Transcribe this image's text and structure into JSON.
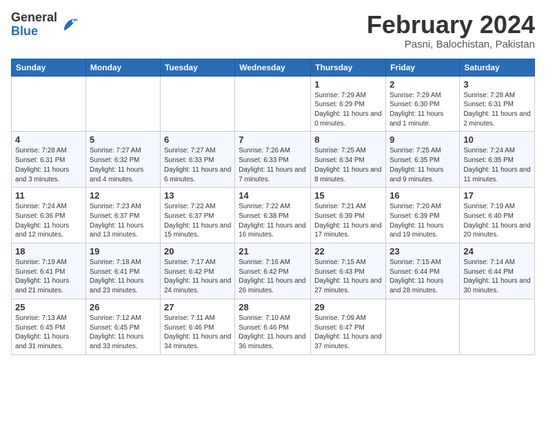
{
  "logo": {
    "general": "General",
    "blue": "Blue"
  },
  "title": "February 2024",
  "subtitle": "Pasni, Balochistan, Pakistan",
  "days_of_week": [
    "Sunday",
    "Monday",
    "Tuesday",
    "Wednesday",
    "Thursday",
    "Friday",
    "Saturday"
  ],
  "weeks": [
    [
      {
        "day": "",
        "info": ""
      },
      {
        "day": "",
        "info": ""
      },
      {
        "day": "",
        "info": ""
      },
      {
        "day": "",
        "info": ""
      },
      {
        "day": "1",
        "info": "Sunrise: 7:29 AM\nSunset: 6:29 PM\nDaylight: 11 hours and 0 minutes."
      },
      {
        "day": "2",
        "info": "Sunrise: 7:29 AM\nSunset: 6:30 PM\nDaylight: 11 hours and 1 minute."
      },
      {
        "day": "3",
        "info": "Sunrise: 7:28 AM\nSunset: 6:31 PM\nDaylight: 11 hours and 2 minutes."
      }
    ],
    [
      {
        "day": "4",
        "info": "Sunrise: 7:28 AM\nSunset: 6:31 PM\nDaylight: 11 hours and 3 minutes."
      },
      {
        "day": "5",
        "info": "Sunrise: 7:27 AM\nSunset: 6:32 PM\nDaylight: 11 hours and 4 minutes."
      },
      {
        "day": "6",
        "info": "Sunrise: 7:27 AM\nSunset: 6:33 PM\nDaylight: 11 hours and 6 minutes."
      },
      {
        "day": "7",
        "info": "Sunrise: 7:26 AM\nSunset: 6:33 PM\nDaylight: 11 hours and 7 minutes."
      },
      {
        "day": "8",
        "info": "Sunrise: 7:25 AM\nSunset: 6:34 PM\nDaylight: 11 hours and 8 minutes."
      },
      {
        "day": "9",
        "info": "Sunrise: 7:25 AM\nSunset: 6:35 PM\nDaylight: 11 hours and 9 minutes."
      },
      {
        "day": "10",
        "info": "Sunrise: 7:24 AM\nSunset: 6:35 PM\nDaylight: 11 hours and 11 minutes."
      }
    ],
    [
      {
        "day": "11",
        "info": "Sunrise: 7:24 AM\nSunset: 6:36 PM\nDaylight: 11 hours and 12 minutes."
      },
      {
        "day": "12",
        "info": "Sunrise: 7:23 AM\nSunset: 6:37 PM\nDaylight: 11 hours and 13 minutes."
      },
      {
        "day": "13",
        "info": "Sunrise: 7:22 AM\nSunset: 6:37 PM\nDaylight: 11 hours and 15 minutes."
      },
      {
        "day": "14",
        "info": "Sunrise: 7:22 AM\nSunset: 6:38 PM\nDaylight: 11 hours and 16 minutes."
      },
      {
        "day": "15",
        "info": "Sunrise: 7:21 AM\nSunset: 6:39 PM\nDaylight: 11 hours and 17 minutes."
      },
      {
        "day": "16",
        "info": "Sunrise: 7:20 AM\nSunset: 6:39 PM\nDaylight: 11 hours and 19 minutes."
      },
      {
        "day": "17",
        "info": "Sunrise: 7:19 AM\nSunset: 6:40 PM\nDaylight: 11 hours and 20 minutes."
      }
    ],
    [
      {
        "day": "18",
        "info": "Sunrise: 7:19 AM\nSunset: 6:41 PM\nDaylight: 11 hours and 21 minutes."
      },
      {
        "day": "19",
        "info": "Sunrise: 7:18 AM\nSunset: 6:41 PM\nDaylight: 11 hours and 23 minutes."
      },
      {
        "day": "20",
        "info": "Sunrise: 7:17 AM\nSunset: 6:42 PM\nDaylight: 11 hours and 24 minutes."
      },
      {
        "day": "21",
        "info": "Sunrise: 7:16 AM\nSunset: 6:42 PM\nDaylight: 11 hours and 26 minutes."
      },
      {
        "day": "22",
        "info": "Sunrise: 7:15 AM\nSunset: 6:43 PM\nDaylight: 11 hours and 27 minutes."
      },
      {
        "day": "23",
        "info": "Sunrise: 7:15 AM\nSunset: 6:44 PM\nDaylight: 11 hours and 28 minutes."
      },
      {
        "day": "24",
        "info": "Sunrise: 7:14 AM\nSunset: 6:44 PM\nDaylight: 11 hours and 30 minutes."
      }
    ],
    [
      {
        "day": "25",
        "info": "Sunrise: 7:13 AM\nSunset: 6:45 PM\nDaylight: 11 hours and 31 minutes."
      },
      {
        "day": "26",
        "info": "Sunrise: 7:12 AM\nSunset: 6:45 PM\nDaylight: 11 hours and 33 minutes."
      },
      {
        "day": "27",
        "info": "Sunrise: 7:11 AM\nSunset: 6:46 PM\nDaylight: 11 hours and 34 minutes."
      },
      {
        "day": "28",
        "info": "Sunrise: 7:10 AM\nSunset: 6:46 PM\nDaylight: 11 hours and 36 minutes."
      },
      {
        "day": "29",
        "info": "Sunrise: 7:09 AM\nSunset: 6:47 PM\nDaylight: 11 hours and 37 minutes."
      },
      {
        "day": "",
        "info": ""
      },
      {
        "day": "",
        "info": ""
      }
    ]
  ]
}
